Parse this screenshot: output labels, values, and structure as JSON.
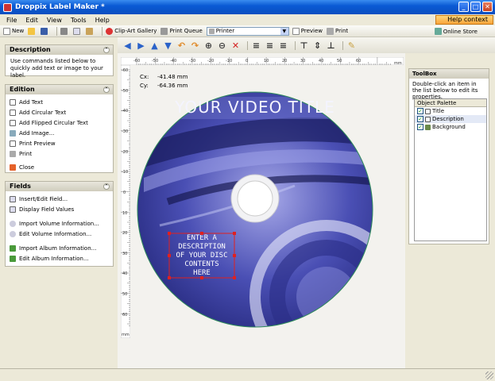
{
  "window": {
    "title": "Droppix Label Maker *"
  },
  "menu": [
    "File",
    "Edit",
    "View",
    "Tools",
    "Help"
  ],
  "help_context": "Help context",
  "toolbar": {
    "new": "New",
    "clipart": "Clip-Art Gallery",
    "print_queue": "Print Queue",
    "printer": "Printer",
    "preview": "Preview",
    "print": "Print",
    "online_store": "Online Store"
  },
  "left": {
    "description_title": "Description",
    "description_text": "Use commands listed below to quickly add text or image to your label.",
    "edition_title": "Edition",
    "edition_items": [
      "Add Text",
      "Add Circular Text",
      "Add Flipped Circular Text",
      "Add Image...",
      "Print Preview",
      "Print",
      "Close"
    ],
    "fields_title": "Fields",
    "fields_items": [
      "Insert/Edit Field...",
      "Display Field Values",
      "Import Volume Information...",
      "Edit Volume Information...",
      "Import Album Information...",
      "Edit Album Information..."
    ]
  },
  "rulers": {
    "h_labels": [
      "-60",
      "-50",
      "-40",
      "-30",
      "-20",
      "-10",
      "0",
      "10",
      "20",
      "30",
      "40",
      "50",
      "60"
    ],
    "v_labels": [
      "-60",
      "-50",
      "-40",
      "-30",
      "-20",
      "-10",
      "0",
      "10",
      "20",
      "30",
      "40",
      "50",
      "60"
    ],
    "unit": "mm"
  },
  "coords": {
    "cx_label": "Cx:",
    "cx": "-41.48 mm",
    "cy_label": "Cy:",
    "cy": "-64.36 mm"
  },
  "disc": {
    "title": "YOUR VIDEO TITLE",
    "description_lines": [
      "ENTER A",
      "DESCRIPTION",
      "OF YOUR DISC",
      "CONTENTS",
      "HERE"
    ]
  },
  "toolbox": {
    "title": "ToolBox",
    "description": "Double-click an item in the list below to edit its properties.",
    "palette_title": "Object Palette",
    "objects": [
      "Title",
      "Description",
      "Background"
    ]
  },
  "colors": {
    "accent": "#0a5ad4",
    "disc_tint": "#5a60c8",
    "selection": "#e02020"
  }
}
